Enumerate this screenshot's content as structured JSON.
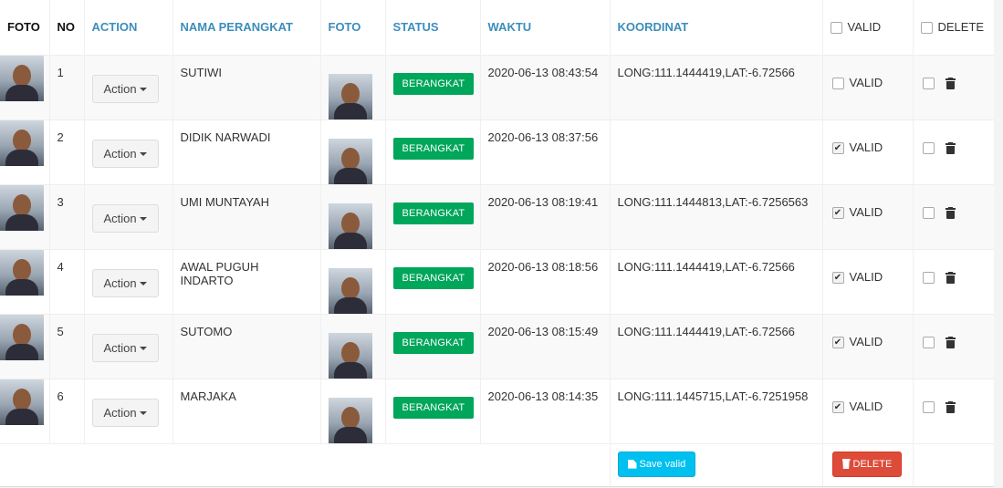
{
  "headers": {
    "foto": "FOTO",
    "no": "NO",
    "action": "ACTION",
    "nama": "NAMA PERANGKAT",
    "foto2": "FOTO",
    "status": "STATUS",
    "waktu": "WAKTU",
    "koordinat": "KOORDINAT",
    "valid": "VALID",
    "delete": "DELETE"
  },
  "rows": [
    {
      "no": "1",
      "action": "Action",
      "nama": "SUTIWI",
      "status": "BERANGKAT",
      "waktu": "2020-06-13 08:43:54",
      "koordinat": "LONG:111.1444419,LAT:-6.72566",
      "valid_label": "VALID",
      "valid_checked": false
    },
    {
      "no": "2",
      "action": "Action",
      "nama": "DIDIK NARWADI",
      "status": "BERANGKAT",
      "waktu": "2020-06-13 08:37:56",
      "koordinat": "",
      "valid_label": "VALID",
      "valid_checked": true
    },
    {
      "no": "3",
      "action": "Action",
      "nama": "UMI MUNTAYAH",
      "status": "BERANGKAT",
      "waktu": "2020-06-13 08:19:41",
      "koordinat": "LONG:111.1444813,LAT:-6.7256563",
      "valid_label": "VALID",
      "valid_checked": true
    },
    {
      "no": "4",
      "action": "Action",
      "nama": "AWAL PUGUH INDARTO",
      "status": "BERANGKAT",
      "waktu": "2020-06-13 08:18:56",
      "koordinat": "LONG:111.1444419,LAT:-6.72566",
      "valid_label": "VALID",
      "valid_checked": true
    },
    {
      "no": "5",
      "action": "Action",
      "nama": "SUTOMO",
      "status": "BERANGKAT",
      "waktu": "2020-06-13 08:15:49",
      "koordinat": "LONG:111.1444419,LAT:-6.72566",
      "valid_label": "VALID",
      "valid_checked": true
    },
    {
      "no": "6",
      "action": "Action",
      "nama": "MARJAKA",
      "status": "BERANGKAT",
      "waktu": "2020-06-13 08:14:35",
      "koordinat": "LONG:111.1445715,LAT:-6.7251958",
      "valid_label": "VALID",
      "valid_checked": true
    }
  ],
  "footer": {
    "save_label": "Save valid",
    "delete_label": "DELETE"
  },
  "colors": {
    "header_blue": "#3c8dbc",
    "status_green": "#00a65a",
    "save_cyan": "#00c0ef",
    "delete_red": "#dd4b39"
  },
  "icons": {
    "delete_row": "trash-icon",
    "save": "save-icon",
    "delete_all": "trash-icon"
  }
}
